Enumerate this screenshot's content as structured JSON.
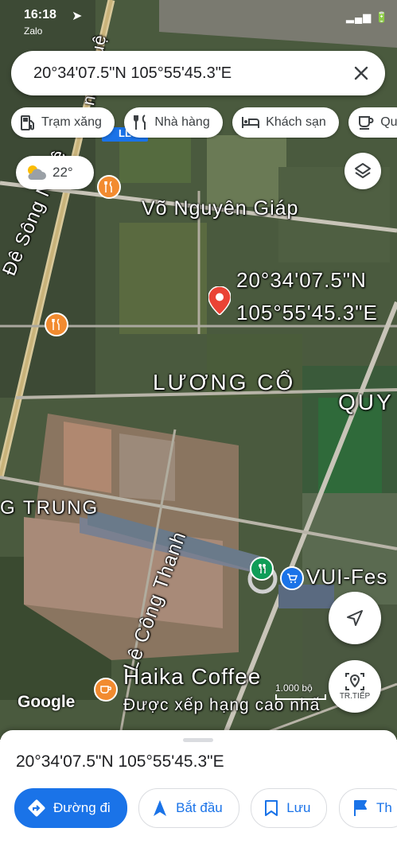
{
  "status": {
    "time": "16:18",
    "sub": "Zalo",
    "system_icons": "▂▄▆ 🔋"
  },
  "search": {
    "query": "20°34'07.5\"N 105°55'45.3\"E"
  },
  "chips": [
    {
      "label": "Trạm xăng",
      "icon": "gas-station-icon"
    },
    {
      "label": "Nhà hàng",
      "icon": "restaurant-icon"
    },
    {
      "label": "Khách sạn",
      "icon": "hotel-icon"
    },
    {
      "label": "Qu",
      "icon": "coffee-icon"
    }
  ],
  "weather": {
    "temp": "22°",
    "icon": "partly-cloudy-icon"
  },
  "map_labels": {
    "road_top": "Võ Nguyên Giáp",
    "de_song": "Đê Sông Nhuệ",
    "nhue_top": "nh Nhuệ",
    "luong_co": "LƯƠNG CỔ",
    "quy": "QUY",
    "g_trung": "G TRUNG",
    "le_cong_thanh": "Lê Công Thanh",
    "vui_fest": "VUI-Fes",
    "haika": "Haika Coffee",
    "haika_sub": "Được xếp hạng cao nhấ",
    "pin_line1": "20°34'07.5\"N",
    "pin_line2": "105°55'45.3\"E",
    "route_badge": "LL"
  },
  "scale_label": "1.000 bộ",
  "google_logo": "Google",
  "transit_label": "TR.TIẾP",
  "sheet": {
    "coordinates": "20°34'07.5\"N 105°55'45.3\"E",
    "actions": [
      {
        "label": "Đường đi",
        "icon": "directions-icon",
        "primary": true
      },
      {
        "label": "Bắt đầu",
        "icon": "navigation-arrow-icon",
        "primary": false
      },
      {
        "label": "Lưu",
        "icon": "bookmark-icon",
        "primary": false
      },
      {
        "label": "Th",
        "icon": "flag-icon",
        "primary": false
      }
    ]
  },
  "colors": {
    "accent": "#1a73e8",
    "pin": "#ea4335",
    "poi": "#f28b30"
  }
}
